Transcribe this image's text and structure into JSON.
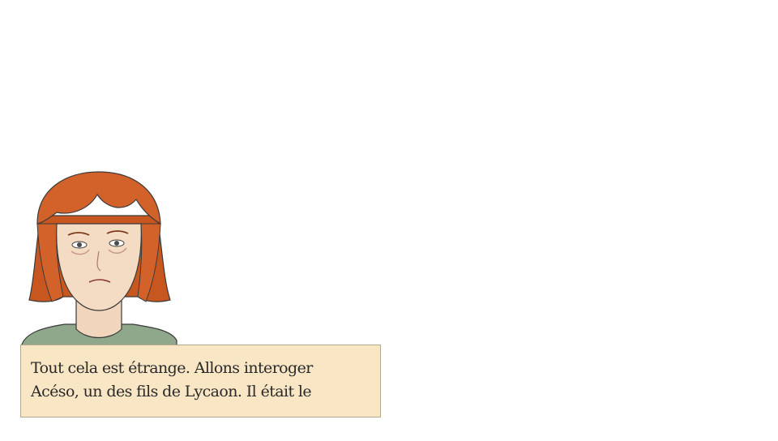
{
  "dialog": {
    "text": "Tout cela est étrange. Allons interoger\nAcéso, un des fils de Lycaon. Il était le"
  },
  "portrait": {
    "icon": "red-haired-woman-portrait",
    "hair_color": "#d2622a",
    "skin_color": "#f4dcc4",
    "shirt_color": "#8fa88c"
  },
  "colors": {
    "background": "#ffffff",
    "dialog_bg": "#f8e6c5",
    "dialog_border": "#b9a887",
    "text": "#2a2a2a"
  }
}
